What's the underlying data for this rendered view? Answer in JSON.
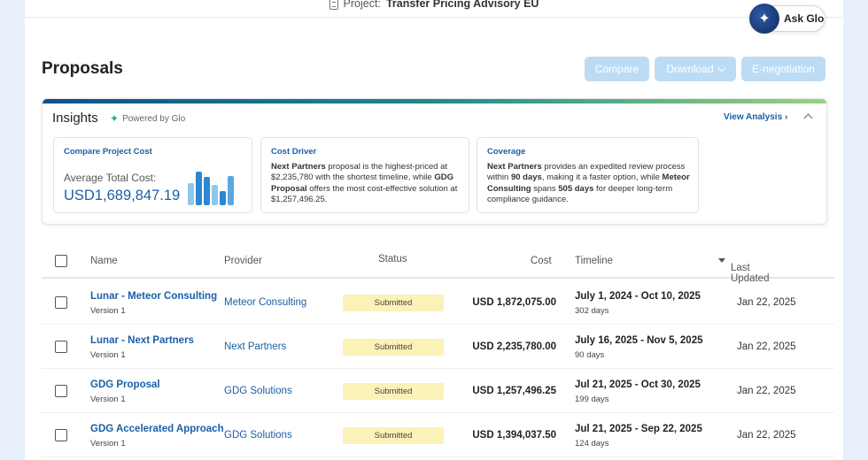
{
  "project": {
    "prefix": "Project:",
    "name": "Transfer Pricing Advisory EU"
  },
  "ask_glo": {
    "label": "Ask Glo",
    "icon": "sparkle-icon"
  },
  "page_title": "Proposals",
  "actions": {
    "compare": "Compare",
    "download": "Download",
    "e_negotiation": "E-negotiation"
  },
  "insights": {
    "title": "Insights",
    "powered_by": "Powered by Glo",
    "view_analysis": "View Analysis",
    "view_analysis_chevron": "›",
    "cards": {
      "cost": {
        "title": "Compare Project Cost",
        "label": "Average Total Cost:",
        "value": "USD1,689,847.19",
        "bar_levels": [
          0.65,
          1.0,
          0.85,
          0.6,
          0.42,
          0.87
        ],
        "bar_colors": [
          "#8fc7ea",
          "#2b88cf",
          "#2b88cf",
          "#8fc7ea",
          "#2b88cf",
          "#5aa8e0"
        ]
      },
      "driver": {
        "title": "Cost Driver",
        "parts": {
          "a": "Next Partners",
          "b": " proposal is the highest-priced at $2,235,780 with the shortest timeline, while ",
          "c": "GDG Proposal",
          "d": " offers the most cost-effective solution at $1,257,496.25."
        }
      },
      "coverage": {
        "title": "Coverage",
        "parts": {
          "a": "Next Partners",
          "b": " provides an expedited review process within ",
          "c": "90 days",
          "d": ", making it a faster option, while ",
          "e": "Meteor Consulting",
          "f": " spans ",
          "g": "505 days",
          "h": " for deeper long-term compliance guidance."
        }
      }
    }
  },
  "table": {
    "headers": {
      "name": "Name",
      "provider": "Provider",
      "status": "Status",
      "cost": "Cost",
      "timeline": "Timeline",
      "last_updated": "Last Updated"
    },
    "rows": [
      {
        "name": "Lunar - Meteor Consulting",
        "version": "Version 1",
        "provider": "Meteor Consulting",
        "status": "Submitted",
        "cost": "USD 1,872,075.00",
        "timeline": "July 1, 2024 - Oct 10, 2025",
        "days": "302 days",
        "updated": "Jan 22, 2025"
      },
      {
        "name": "Lunar - Next Partners",
        "version": "Version 1",
        "provider": "Next Partners",
        "status": "Submitted",
        "cost": "USD 2,235,780.00",
        "timeline": "July 16, 2025 - Nov 5, 2025",
        "days": "90 days",
        "updated": "Jan 22, 2025"
      },
      {
        "name": "GDG Proposal",
        "version": "Version 1",
        "provider": "GDG Solutions",
        "status": "Submitted",
        "cost": "USD 1,257,496.25",
        "timeline": "Jul 21, 2025 - Oct 30, 2025",
        "days": "199 days",
        "updated": "Jan 22, 2025"
      },
      {
        "name": "GDG Accelerated Approach",
        "version": "Version 1",
        "provider": "GDG Solutions",
        "status": "Submitted",
        "cost": "USD 1,394,037.50",
        "timeline": "Jul 21, 2025 - Sep 22, 2025",
        "days": "124 days",
        "updated": "Jan 22, 2025"
      }
    ]
  }
}
